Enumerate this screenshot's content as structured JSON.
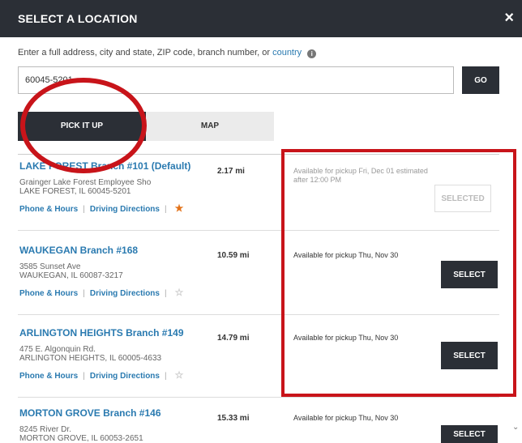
{
  "header": {
    "title": "SELECT A LOCATION",
    "close_glyph": "×",
    "close_icon": "close-icon"
  },
  "instruction": {
    "text": "Enter a full address, city and state, ZIP code, branch number, or ",
    "link": "country",
    "info_glyph": "i",
    "info_icon": "info-icon"
  },
  "search": {
    "value": "60045-5201",
    "go_label": "GO"
  },
  "tabs": [
    {
      "label": "PICK IT UP"
    },
    {
      "label": "MAP"
    }
  ],
  "branches": [
    {
      "name": "LAKE FOREST Branch #101 (Default)",
      "address_line1": "Grainger Lake Forest Employee Sho",
      "address_line2": "LAKE FOREST, IL 60045-5201",
      "distance": "2.17 mi",
      "availability": "Available for pickup Fri, Dec 01 estimated after 12:00 PM",
      "select_label": "SELECTED",
      "phone_hours": "Phone & Hours",
      "directions": "Driving Directions",
      "star_glyph": "★"
    },
    {
      "name": "WAUKEGAN Branch #168",
      "address_line1": "3585 Sunset Ave",
      "address_line2": "WAUKEGAN, IL 60087-3217",
      "distance": "10.59 mi",
      "availability": "Available for pickup Thu, Nov 30",
      "select_label": "SELECT",
      "phone_hours": "Phone & Hours",
      "directions": "Driving Directions",
      "star_glyph": "☆"
    },
    {
      "name": "ARLINGTON HEIGHTS Branch #149",
      "address_line1": "475 E. Algonquin Rd.",
      "address_line2": "ARLINGTON HEIGHTS, IL 60005-4633",
      "distance": "14.79 mi",
      "availability": "Available for pickup Thu, Nov 30",
      "select_label": "SELECT",
      "phone_hours": "Phone & Hours",
      "directions": "Driving Directions",
      "star_glyph": "☆"
    },
    {
      "name": "MORTON GROVE Branch #146",
      "address_line1": "8245 River Dr.",
      "address_line2": "MORTON GROVE, IL 60053-2651",
      "distance": "15.33 mi",
      "availability": "Available for pickup Thu, Nov 30",
      "select_label": "SELECT"
    }
  ],
  "links_separator": "|",
  "scroll_glyph": "⌄",
  "colors": {
    "header_bg": "#2b2f36",
    "link": "#2a7ab0",
    "annotation": "#c8141a",
    "star": "#e3731a"
  }
}
